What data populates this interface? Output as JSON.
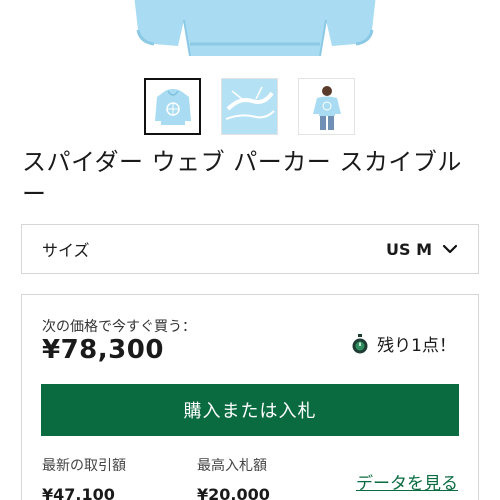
{
  "product": {
    "title": "スパイダー ウェブ パーカー スカイブルー",
    "thumbnails": [
      "hoodie-front-thumbnail",
      "hoodie-detail-thumbnail",
      "model-wearing-thumbnail"
    ],
    "accent_color": "#0a6b40",
    "product_color": "#a9dcf2"
  },
  "size_selector": {
    "label": "サイズ",
    "value": "US M"
  },
  "buy": {
    "caption": "次の価格で今すぐ買う：",
    "price": "¥78,300",
    "remaining": "残り1点！",
    "button_label": "購入または入札"
  },
  "stats": {
    "last_sale_label": "最新の取引額",
    "last_sale_value": "¥47,100",
    "highest_bid_label": "最高入札額",
    "highest_bid_value": "¥20,000",
    "data_link": "データを見る"
  }
}
